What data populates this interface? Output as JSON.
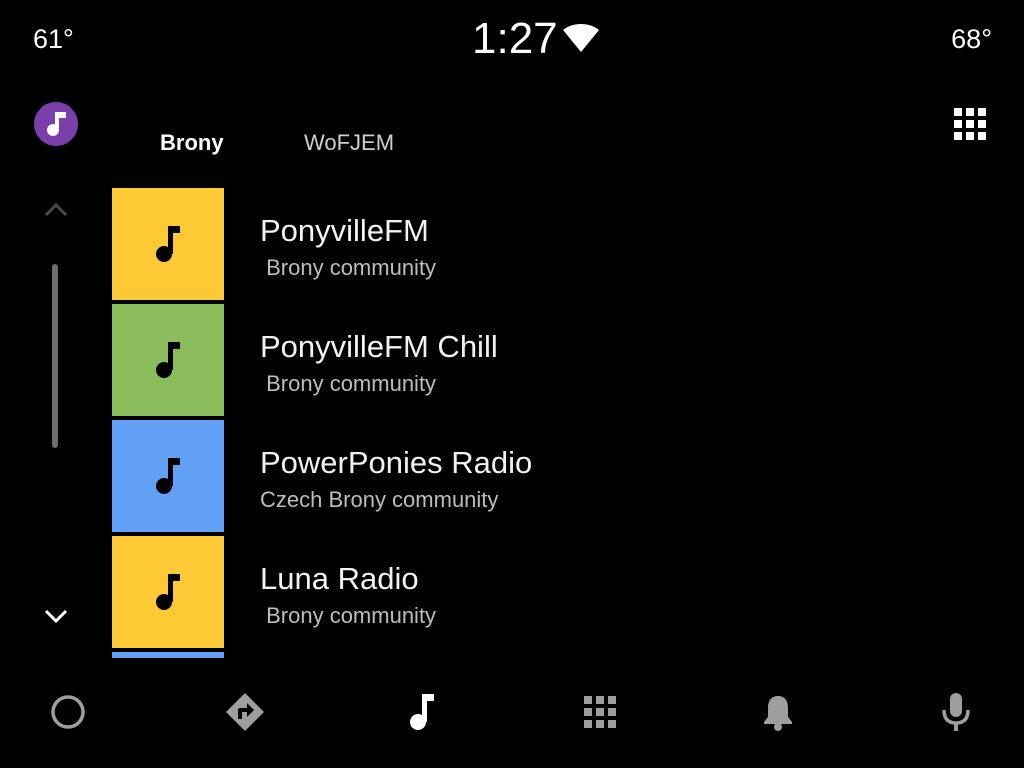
{
  "status_bar": {
    "temp_left": "61°",
    "time": "1:27",
    "temp_right": "68°",
    "wifi_icon": "wifi-icon"
  },
  "header": {
    "app_icon": "music-note-icon",
    "app_icon_color": "#7a3fa8",
    "tabs": [
      {
        "label": "Brony",
        "selected": true
      },
      {
        "label": "WoFJEM",
        "selected": false
      }
    ],
    "apps_icon": "grid-icon"
  },
  "scroll": {
    "up_icon": "chevron-up-icon",
    "down_icon": "chevron-down-icon"
  },
  "stations": [
    {
      "title": "PonyvilleFM",
      "subtitle": " Brony community",
      "color": "#fdc935"
    },
    {
      "title": "PonyvilleFM Chill",
      "subtitle": " Brony community",
      "color": "#8bbc5c"
    },
    {
      "title": "PowerPonies Radio",
      "subtitle": "Czech Brony community",
      "color": "#62a0f6"
    },
    {
      "title": "Luna Radio",
      "subtitle": " Brony community",
      "color": "#fdc935"
    }
  ],
  "peek_color": "#62a0f6",
  "nav": {
    "items": [
      {
        "name": "home",
        "icon": "circle-icon",
        "active": false
      },
      {
        "name": "navigation",
        "icon": "directions-icon",
        "active": false
      },
      {
        "name": "media",
        "icon": "music-note-icon",
        "active": true
      },
      {
        "name": "apps",
        "icon": "grid-icon",
        "active": false
      },
      {
        "name": "notifications",
        "icon": "bell-icon",
        "active": false
      },
      {
        "name": "voice",
        "icon": "microphone-icon",
        "active": false
      }
    ],
    "active_color": "#ffffff",
    "inactive_color": "#9e9e9e"
  }
}
